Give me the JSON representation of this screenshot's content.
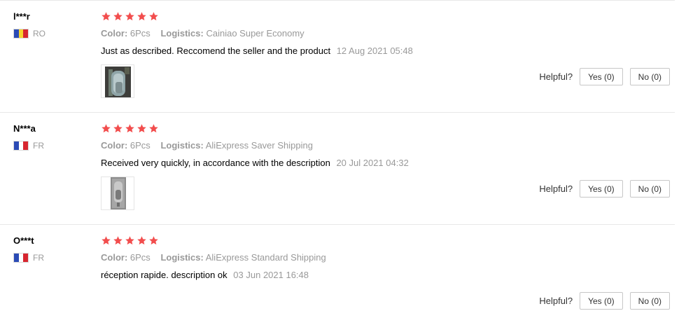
{
  "reviews": [
    {
      "user": "l***r",
      "country_code": "RO",
      "flag_colors": [
        "#2b4bb5",
        "#f6d32d",
        "#d7262f"
      ],
      "rating": 5,
      "color_label": "Color:",
      "color_value": "6Pcs",
      "logistics_label": "Logistics:",
      "logistics_value": "Cainiao Super Economy",
      "text": "Just as described. Reccomend the seller and the product",
      "date": "12 Aug 2021 05:48",
      "has_image": true,
      "helpful_label": "Helpful?",
      "yes_label": "Yes (0)",
      "no_label": "No (0)"
    },
    {
      "user": "N***a",
      "country_code": "FR",
      "flag_colors": [
        "#2b4bb5",
        "#ffffff",
        "#d7262f"
      ],
      "rating": 5,
      "color_label": "Color:",
      "color_value": "6Pcs",
      "logistics_label": "Logistics:",
      "logistics_value": "AliExpress Saver Shipping",
      "text": "Received very quickly, in accordance with the description",
      "date": "20 Jul 2021 04:32",
      "has_image": true,
      "helpful_label": "Helpful?",
      "yes_label": "Yes (0)",
      "no_label": "No (0)"
    },
    {
      "user": "O***t",
      "country_code": "FR",
      "flag_colors": [
        "#2b4bb5",
        "#ffffff",
        "#d7262f"
      ],
      "rating": 5,
      "color_label": "Color:",
      "color_value": "6Pcs",
      "logistics_label": "Logistics:",
      "logistics_value": "AliExpress Standard Shipping",
      "text": "réception rapide. description ok",
      "date": "03 Jun 2021 16:48",
      "has_image": false,
      "helpful_label": "Helpful?",
      "yes_label": "Yes (0)",
      "no_label": "No (0)"
    }
  ],
  "colors": {
    "star": "#f24d4d",
    "muted_text": "#999999",
    "divider": "#e8e8e8"
  },
  "icons": {
    "rating": "star-icon",
    "country": "flag-icon",
    "photo": "review-photo-thumbnail"
  }
}
